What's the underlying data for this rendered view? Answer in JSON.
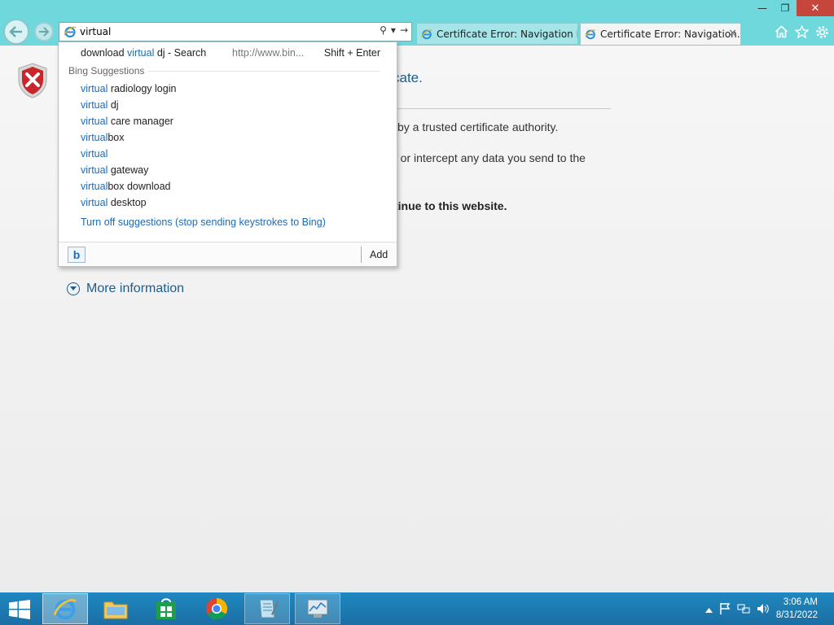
{
  "window": {
    "minimize_glyph": "—",
    "restore_glyph": "❐",
    "close_glyph": "✕"
  },
  "address_bar": {
    "value": "virtual",
    "search_glyph": "⚲",
    "dropdown_glyph": "▾",
    "go_glyph": "→"
  },
  "tabs": [
    {
      "label": "Certificate Error: Navigation Bl...",
      "active": false
    },
    {
      "label": "Certificate Error: Navigation...",
      "active": true,
      "close_glyph": "✕"
    }
  ],
  "toolbar_icons": [
    "home-icon",
    "favorites-star-icon",
    "settings-gear-icon"
  ],
  "page": {
    "heading": "cate.",
    "line1": "by a trusted certificate authority.",
    "line2": "u or intercept any data you send to the",
    "line3": "",
    "line4": "tinue to this website.",
    "more_information": "More information"
  },
  "dropdown": {
    "search_row": {
      "prefix": "download ",
      "highlight": "virtual",
      "suffix": " dj - Search",
      "url": "http://www.bin...",
      "shortcut": "Shift + Enter"
    },
    "section_title": "Bing Suggestions",
    "suggestions": [
      {
        "highlight": "virtual",
        "rest": " radiology login"
      },
      {
        "highlight": "virtual",
        "rest": " dj"
      },
      {
        "highlight": "virtual",
        "rest": " care manager"
      },
      {
        "highlight": "virtual",
        "rest": "box"
      },
      {
        "highlight": "virtual",
        "rest": ""
      },
      {
        "highlight": "virtual",
        "rest": " gateway"
      },
      {
        "highlight": "virtual",
        "rest": "box download"
      },
      {
        "highlight": "virtual",
        "rest": " desktop"
      }
    ],
    "turn_off": "Turn off suggestions (stop sending keystrokes to Bing)",
    "provider_icon": "b",
    "add_label": "Add"
  },
  "taskbar": {
    "apps": [
      "internet-explorer",
      "file-explorer",
      "store",
      "chrome",
      "notepad",
      "task-manager"
    ],
    "tray_icons": [
      "show-hidden-icons",
      "action-center-flag",
      "network",
      "volume"
    ],
    "time": "3:06 AM",
    "date": "8/31/2022"
  },
  "colors": {
    "titlebar": "#6fd8dd",
    "link_blue": "#1e6ab3",
    "heading_blue": "#1f5c8a",
    "taskbar": "#1b6ea3"
  }
}
